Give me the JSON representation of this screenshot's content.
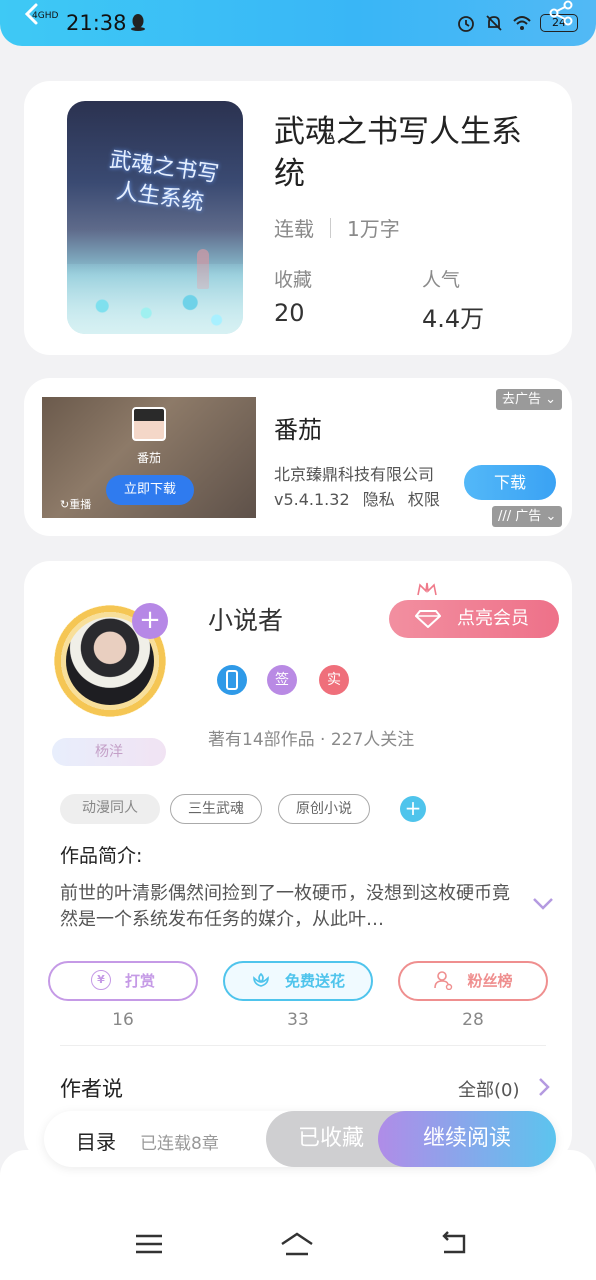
{
  "status_bar": {
    "network": "4GHD",
    "time": "21:38",
    "battery": "24"
  },
  "book": {
    "cover_title": "武魂之书写人生系统",
    "title": "武魂之书写人生系统",
    "status": "连载",
    "word_count": "1万字",
    "favorites_label": "收藏",
    "favorites_value": "20",
    "popularity_label": "人气",
    "popularity_value": "4.4万"
  },
  "ad": {
    "video_app_name": "番茄",
    "video_download": "立即下载",
    "video_replay": "重播",
    "app_name": "番茄",
    "company": "北京臻鼎科技有限公司",
    "version": "v5.4.1.32",
    "privacy": "隐私",
    "permissions": "权限",
    "download_label": "下载",
    "remove_ad": "去广告",
    "ad_label": "广告"
  },
  "author": {
    "name": "小说者",
    "tag_name": "杨洋",
    "vip_label": "点亮会员",
    "badges": [
      {
        "text": "",
        "color": "#2f9ae8"
      },
      {
        "text": "签",
        "color": "#b98ae4"
      },
      {
        "text": "实",
        "color": "#ef6f7b"
      }
    ],
    "stats": "著有14部作品 · 227人关注"
  },
  "tags": [
    "动漫同人",
    "三生武魂",
    "原创小说"
  ],
  "intro": {
    "heading": "作品简介:",
    "text": "前世的叶清影偶然间捡到了一枚硬币，没想到这枚硬币竟然是一个系统发布任务的媒介，从此叶…"
  },
  "actions": [
    {
      "label": "打赏",
      "count": "16",
      "color": "#c59ae6"
    },
    {
      "label": "免费送花",
      "count": "33",
      "color": "#4fc4ec"
    },
    {
      "label": "粉丝榜",
      "count": "28",
      "color": "#ef8f8f"
    }
  ],
  "author_says": {
    "label": "作者说",
    "all_label": "全部(0)"
  },
  "bottom_bar": {
    "toc_label": "目录",
    "progress": "已连载8章",
    "collected_label": "已收藏",
    "read_label": "继续阅读"
  },
  "colors": {
    "accent_blue": "#3ec9f5",
    "vip_pink": "#ee7189",
    "read_gradient_start": "#b08ce8",
    "read_gradient_end": "#5cc4ee"
  }
}
